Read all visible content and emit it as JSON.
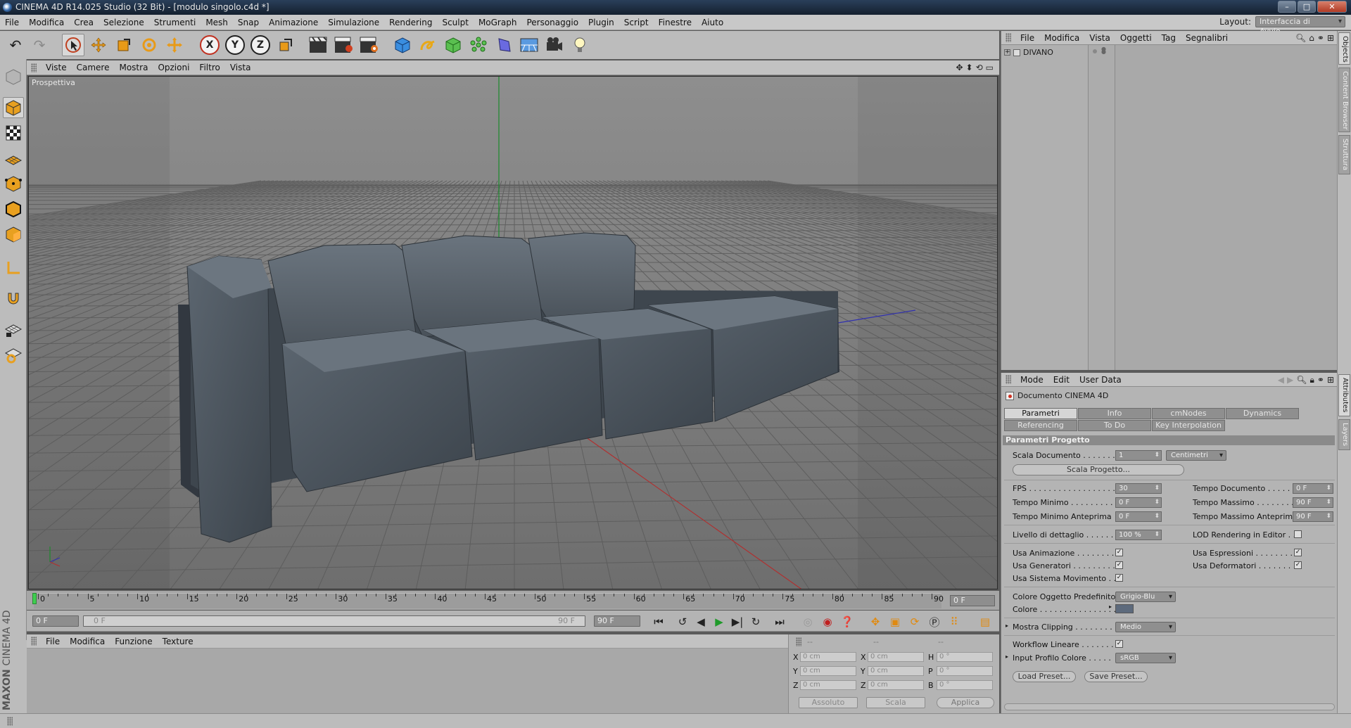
{
  "window": {
    "title": "CINEMA 4D R14.025 Studio (32 Bit) - [modulo singolo.c4d *]",
    "buttons": [
      "–",
      "□",
      "✕"
    ]
  },
  "menubar": {
    "items": [
      "File",
      "Modifica",
      "Crea",
      "Selezione",
      "Strumenti",
      "Mesh",
      "Snap",
      "Animazione",
      "Simulazione",
      "Rendering",
      "Sculpt",
      "MoGraph",
      "Personaggio",
      "Plugin",
      "Script",
      "Finestre",
      "Aiuto"
    ],
    "layout_label": "Layout:",
    "layout_value": "Interfaccia di Avvio"
  },
  "toolbar": {
    "axis_labels": [
      "X",
      "Y",
      "Z"
    ]
  },
  "viewport": {
    "menu": [
      "Viste",
      "Camere",
      "Mostra",
      "Opzioni",
      "Filtro",
      "Vista"
    ],
    "label": "Prospettiva",
    "colors": {
      "bg_top": "#8c8c8c",
      "bg_bottom": "#727272",
      "sofa": "#4f5862",
      "x_axis": "#b03030",
      "y_axis": "#1c8a2c",
      "z_axis": "#3030b0"
    }
  },
  "timeline": {
    "ticks": [
      "0",
      "5",
      "10",
      "15",
      "20",
      "25",
      "30",
      "35",
      "40",
      "45",
      "50",
      "55",
      "60",
      "65",
      "70",
      "75",
      "80",
      "85",
      "90"
    ],
    "end_frame": "0 F",
    "current_start": "0 F",
    "range_start": "0 F",
    "range_end": "90 F",
    "max_field": "90 F"
  },
  "material_manager": {
    "menu": [
      "File",
      "Modifica",
      "Funzione",
      "Texture"
    ]
  },
  "coordinates": {
    "header": [
      "--",
      "--",
      "--"
    ],
    "rows": [
      {
        "axis": "X",
        "pos": "0 cm",
        "size_axis": "X",
        "size": "0 cm",
        "rot_axis": "H",
        "rot": "0 °"
      },
      {
        "axis": "Y",
        "pos": "0 cm",
        "size_axis": "Y",
        "size": "0 cm",
        "rot_axis": "P",
        "rot": "0 °"
      },
      {
        "axis": "Z",
        "pos": "0 cm",
        "size_axis": "Z",
        "size": "0 cm",
        "rot_axis": "B",
        "rot": "0 °"
      }
    ],
    "mode_dropdown": "Assoluto",
    "scale_dropdown": "Scala",
    "apply_button": "Applica"
  },
  "object_manager": {
    "menu": [
      "File",
      "Modifica",
      "Vista",
      "Oggetti",
      "Tag",
      "Segnalibri"
    ],
    "objects": [
      "DIVANO"
    ]
  },
  "attributes": {
    "menu": [
      "Mode",
      "Edit",
      "User Data"
    ],
    "title": "Documento CINEMA 4D",
    "tabs_row1": [
      "Parametri Progetto",
      "Info",
      "cmNodes",
      "Dynamics"
    ],
    "tabs_row2": [
      "Referencing",
      "To Do",
      "Key Interpolation"
    ],
    "section": "Parametri Progetto",
    "scala_documento": {
      "label": "Scala Documento . . . . . . . .",
      "value": "1",
      "unit": "Centimetri"
    },
    "scala_progetto_button": "Scala Progetto...",
    "fps": {
      "label": "FPS . . . . . . . . . . . . . . . . . .",
      "value": "30"
    },
    "tempo_documento": {
      "label": "Tempo Documento . . . . . .",
      "value": "0 F"
    },
    "tempo_minimo": {
      "label": "Tempo Minimo . . . . . . . . .",
      "value": "0 F"
    },
    "tempo_massimo": {
      "label": "Tempo Massimo . . . . . . . .",
      "value": "90 F"
    },
    "tempo_minimo_anteprima": {
      "label": "Tempo Minimo Anteprima",
      "value": "0 F"
    },
    "tempo_massimo_anteprima": {
      "label": "Tempo Massimo Anteprima",
      "value": "90 F"
    },
    "livello_dettaglio": {
      "label": "Livello di dettaglio . . . . . .",
      "value": "100 %"
    },
    "lod_rendering": {
      "label": "LOD Rendering in Editor . .",
      "checked": false
    },
    "usa_animazione": {
      "label": "Usa Animazione . . . . . . . . .",
      "checked": true
    },
    "usa_espressioni": {
      "label": "Usa Espressioni . . . . . . . .",
      "checked": true
    },
    "usa_generatori": {
      "label": "Usa Generatori . . . . . . . . .",
      "checked": true
    },
    "usa_deformatori": {
      "label": "Usa Deformatori . . . . . . . .",
      "checked": true
    },
    "usa_sistema_movimento": {
      "label": "Usa Sistema Movimento . . .",
      "checked": true
    },
    "colore_oggetto_predefinito": {
      "label": "Colore Oggetto Predefinito",
      "value": "Grigio-Blu"
    },
    "colore": {
      "label": "Colore . . . . . . . . . . . . . . . .",
      "swatch": "#5d6a7c"
    },
    "mostra_clipping": {
      "label": "Mostra Clipping . . . . . . . . .",
      "value": "Medio"
    },
    "workflow_lineare": {
      "label": "Workflow Lineare . . . . . . . .",
      "checked": true
    },
    "input_profilo_colore": {
      "label": "Input Profilo Colore . . . . .",
      "value": "sRGB"
    },
    "load_preset": "Load Preset...",
    "save_preset": "Save Preset..."
  },
  "side_tabs": [
    "Objects",
    "Content Browser",
    "Struttura",
    "Attributes",
    "Layers"
  ]
}
